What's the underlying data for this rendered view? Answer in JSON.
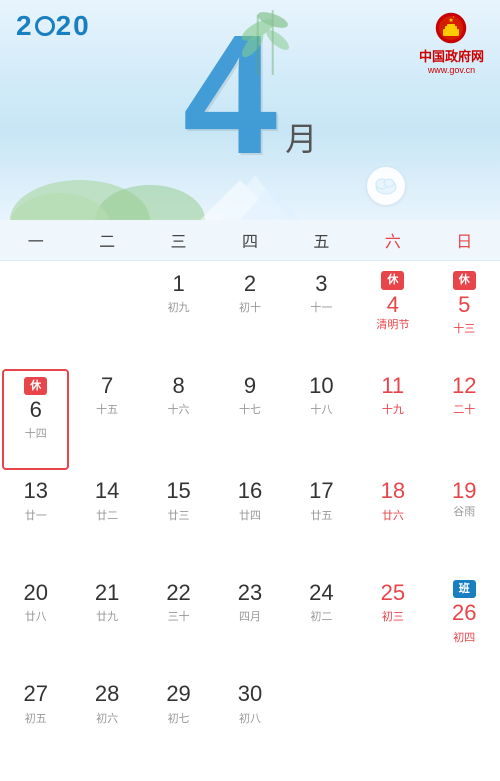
{
  "header": {
    "year": "2020",
    "month_num": "4",
    "month_char": "月",
    "gov_name": "中国政府网",
    "gov_url": "www.gov.cn"
  },
  "weekdays": [
    {
      "label": "一",
      "is_weekend": false
    },
    {
      "label": "二",
      "is_weekend": false
    },
    {
      "label": "三",
      "is_weekend": false
    },
    {
      "label": "四",
      "is_weekend": false
    },
    {
      "label": "五",
      "is_weekend": false
    },
    {
      "label": "六",
      "is_weekend": true
    },
    {
      "label": "日",
      "is_weekend": true
    }
  ],
  "days": [
    {
      "num": "",
      "lunar": "",
      "empty": true
    },
    {
      "num": "",
      "lunar": "",
      "empty": true
    },
    {
      "num": "1",
      "lunar": "初九",
      "weekend": false
    },
    {
      "num": "2",
      "lunar": "初十",
      "weekend": false
    },
    {
      "num": "3",
      "lunar": "十一",
      "weekend": false
    },
    {
      "num": "4",
      "lunar": "清明节",
      "weekend": true,
      "badge": "休",
      "badge_type": "holiday",
      "is_festival": true
    },
    {
      "num": "5",
      "lunar": "十三",
      "weekend": true,
      "badge": "休",
      "badge_type": "holiday"
    },
    {
      "num": "6",
      "lunar": "十四",
      "weekend": false,
      "badge": "休",
      "badge_type": "rest_border"
    },
    {
      "num": "7",
      "lunar": "十五",
      "weekend": false
    },
    {
      "num": "8",
      "lunar": "十六",
      "weekend": false
    },
    {
      "num": "9",
      "lunar": "十七",
      "weekend": false
    },
    {
      "num": "10",
      "lunar": "十八",
      "weekend": false
    },
    {
      "num": "11",
      "lunar": "十九",
      "weekend": true
    },
    {
      "num": "12",
      "lunar": "二十",
      "weekend": true
    },
    {
      "num": "13",
      "lunar": "廿一",
      "weekend": false
    },
    {
      "num": "14",
      "lunar": "廿二",
      "weekend": false
    },
    {
      "num": "15",
      "lunar": "廿三",
      "weekend": false
    },
    {
      "num": "16",
      "lunar": "廿四",
      "weekend": false
    },
    {
      "num": "17",
      "lunar": "廿五",
      "weekend": false
    },
    {
      "num": "18",
      "lunar": "廿六",
      "weekend": true
    },
    {
      "num": "19",
      "lunar": "谷雨",
      "weekend": true,
      "is_festival_gray": true
    },
    {
      "num": "20",
      "lunar": "廿八",
      "weekend": false
    },
    {
      "num": "21",
      "lunar": "廿九",
      "weekend": false
    },
    {
      "num": "22",
      "lunar": "三十",
      "weekend": false
    },
    {
      "num": "23",
      "lunar": "四月",
      "weekend": false
    },
    {
      "num": "24",
      "lunar": "初二",
      "weekend": false
    },
    {
      "num": "25",
      "lunar": "初三",
      "weekend": true
    },
    {
      "num": "26",
      "lunar": "初四",
      "weekend": true,
      "badge": "班",
      "badge_type": "work"
    },
    {
      "num": "27",
      "lunar": "初五",
      "weekend": false
    },
    {
      "num": "28",
      "lunar": "初六",
      "weekend": false
    },
    {
      "num": "29",
      "lunar": "初七",
      "weekend": false
    },
    {
      "num": "30",
      "lunar": "初八",
      "weekend": false
    },
    {
      "num": "",
      "lunar": "",
      "empty": true
    },
    {
      "num": "",
      "lunar": "",
      "empty": true
    },
    {
      "num": "",
      "lunar": "",
      "empty": true
    }
  ]
}
